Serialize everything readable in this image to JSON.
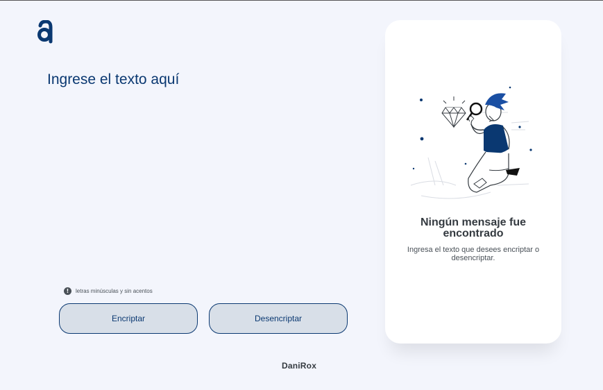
{
  "header": {
    "logo_icon": "alura-a-logo-icon"
  },
  "editor": {
    "placeholder": "Ingrese el texto aquí"
  },
  "hint": {
    "icon": "info-icon",
    "icon_glyph": "!",
    "text": "letras minúsculas y sin acentos"
  },
  "buttons": {
    "encrypt_label": "Encriptar",
    "decrypt_label": "Desencriptar"
  },
  "output_panel": {
    "illustration": "person-with-magnifying-glass-illustration",
    "title": "Ningún mensaje fue encontrado",
    "text": "Ingresa el texto que desees encriptar o desencriptar."
  },
  "footer": {
    "author": "DaniRox"
  },
  "colors": {
    "primary": "#0a3871",
    "background": "#f3f5fc",
    "button_bg": "#d8dfe8",
    "text_dark": "#343a40"
  }
}
